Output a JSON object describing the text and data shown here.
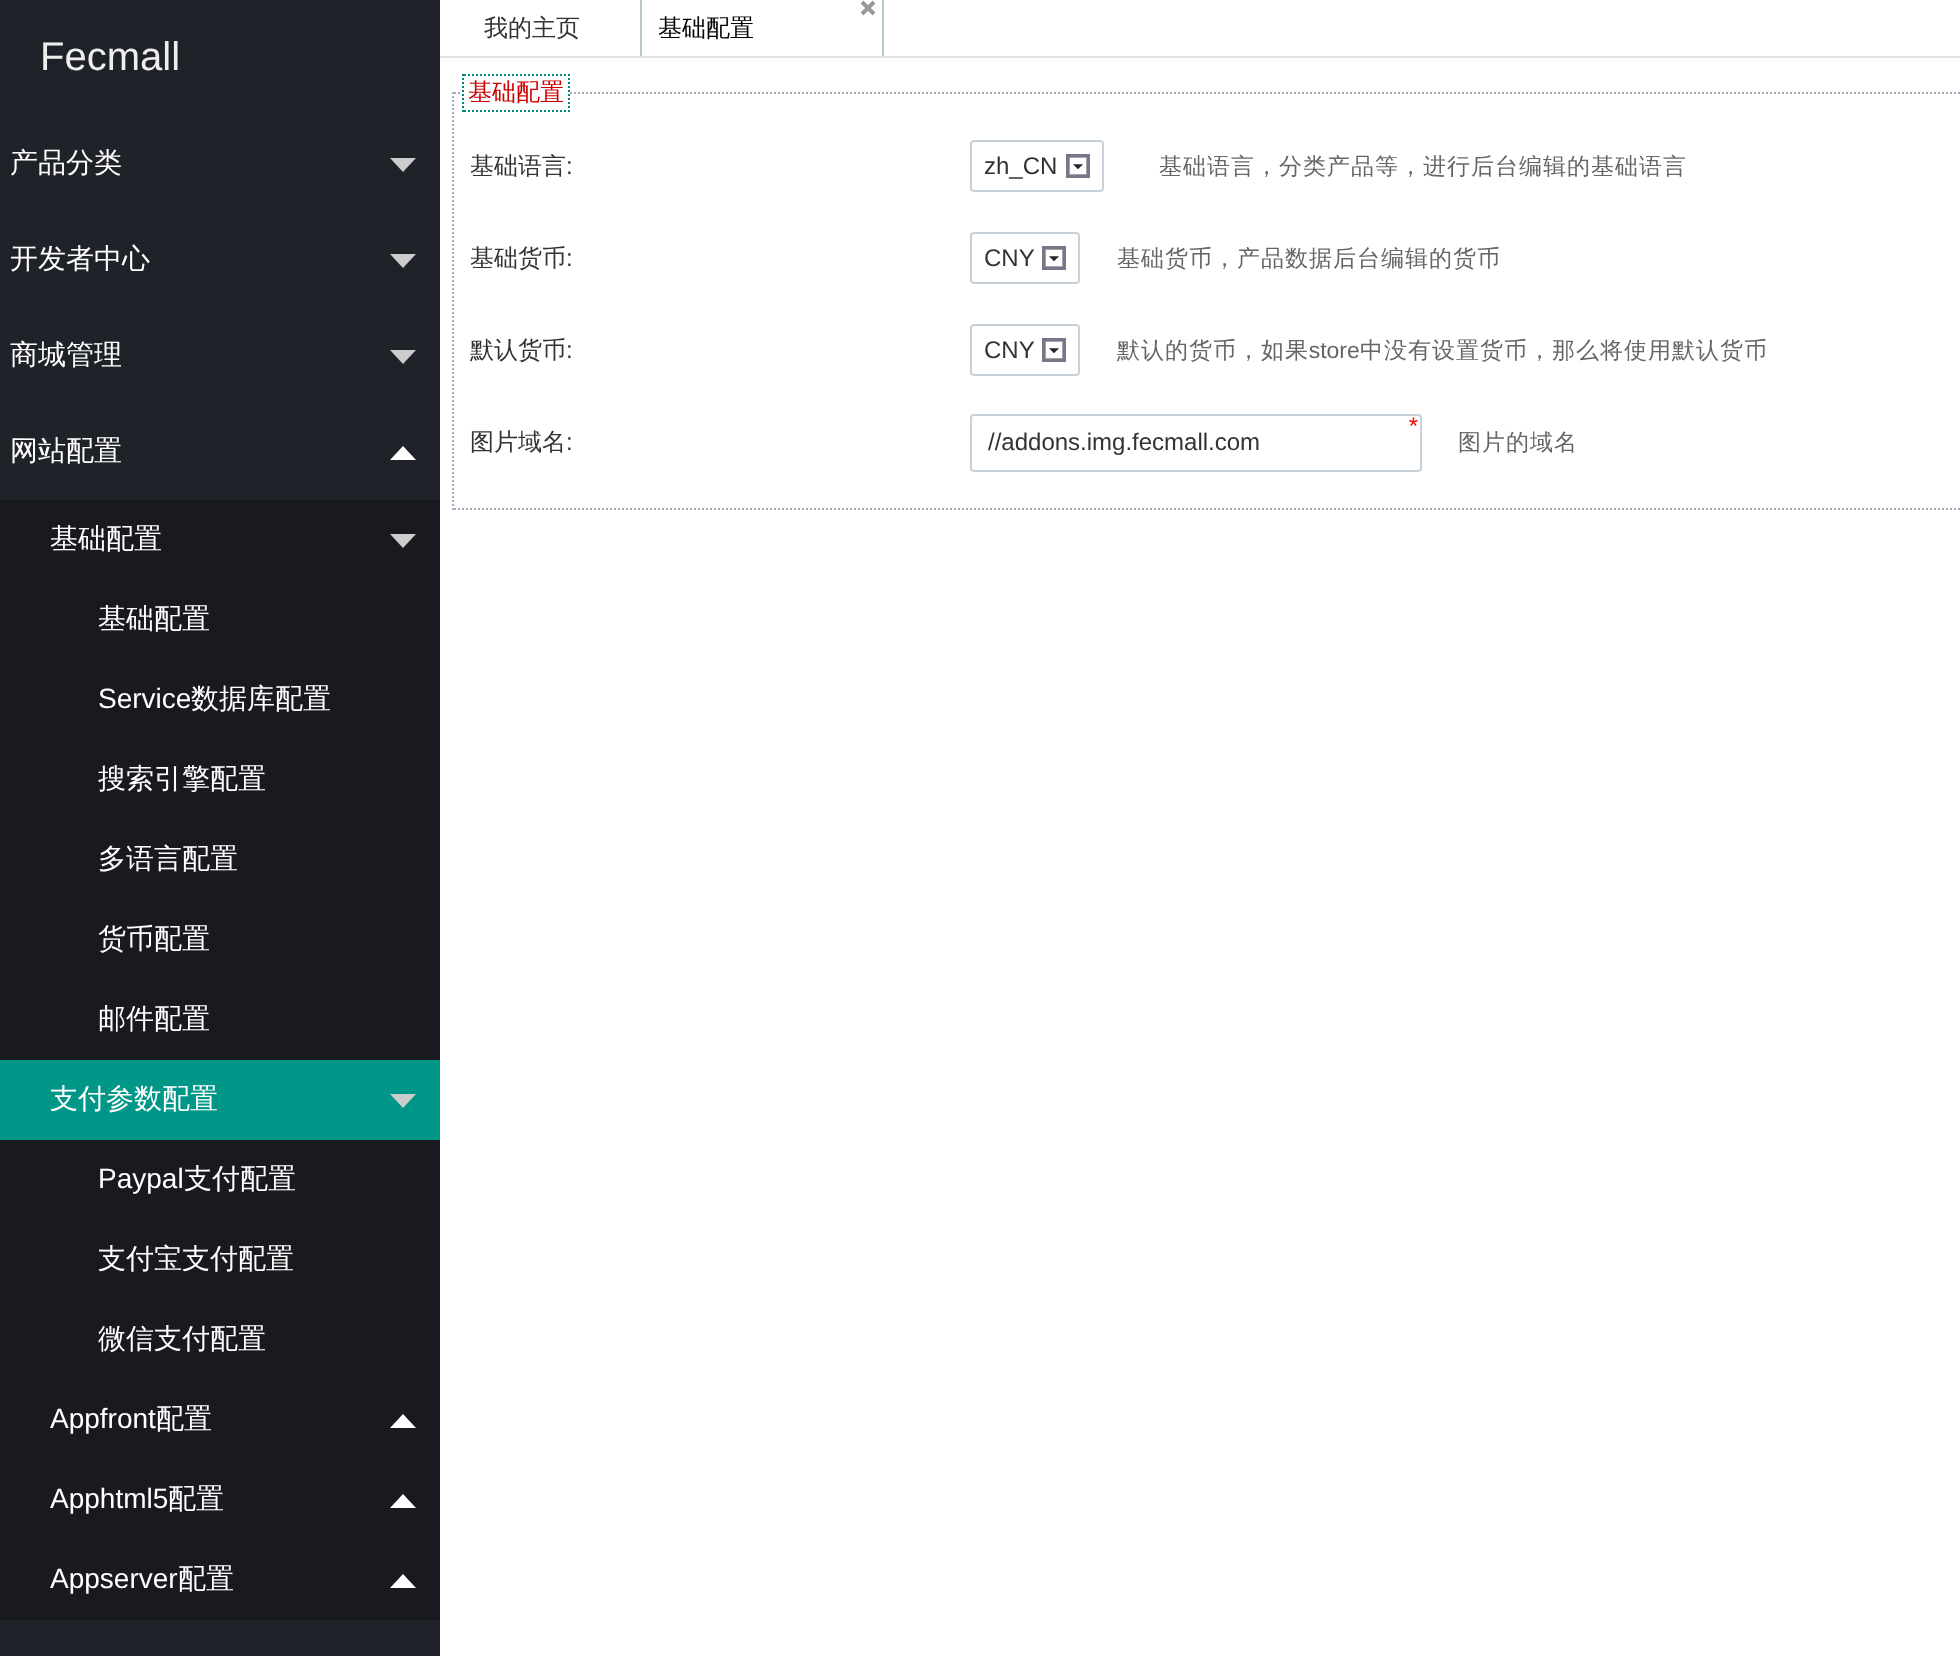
{
  "brand": "Fecmall",
  "sidebar": {
    "items": [
      {
        "label": "产品分类",
        "arrow_up": false,
        "selected": false
      },
      {
        "label": "开发者中心",
        "arrow_up": false,
        "selected": false
      },
      {
        "label": "商城管理",
        "arrow_up": false,
        "selected": false
      },
      {
        "label": "网站配置",
        "arrow_up": true,
        "selected": false,
        "children": [
          {
            "label": "基础配置",
            "arrow_up": false,
            "selected": false,
            "children": [
              {
                "label": "基础配置",
                "selected": false
              },
              {
                "label": "Service数据库配置",
                "selected": false
              },
              {
                "label": "搜索引擎配置",
                "selected": false
              },
              {
                "label": "多语言配置",
                "selected": false
              },
              {
                "label": "货币配置",
                "selected": false
              },
              {
                "label": "邮件配置",
                "selected": false
              }
            ]
          },
          {
            "label": "支付参数配置",
            "arrow_up": false,
            "selected": true,
            "children": [
              {
                "label": "Paypal支付配置",
                "selected": false
              },
              {
                "label": "支付宝支付配置",
                "selected": false
              },
              {
                "label": "微信支付配置",
                "selected": false
              }
            ]
          },
          {
            "label": "Appfront配置",
            "arrow_up": true,
            "selected": false
          },
          {
            "label": "Apphtml5配置",
            "arrow_up": true,
            "selected": false
          },
          {
            "label": "Appserver配置",
            "arrow_up": true,
            "selected": false
          }
        ]
      }
    ]
  },
  "tabs": [
    {
      "label": "我的主页",
      "selected": false,
      "closable": false
    },
    {
      "label": "基础配置",
      "selected": true,
      "closable": true
    }
  ],
  "form": {
    "legend": "基础配置",
    "fields": [
      {
        "kind": "select",
        "label": "基础语言:",
        "value": "zh_CN",
        "help": "基础语言，分类产品等，进行后台编辑的基础语言"
      },
      {
        "kind": "select",
        "label": "基础货币:",
        "value": "CNY",
        "help": "基础货币，产品数据后台编辑的货币"
      },
      {
        "kind": "select",
        "label": "默认货币:",
        "value": "CNY",
        "help": "默认的货币，如果store中没有设置货币，那么将使用默认货币"
      },
      {
        "kind": "text",
        "label": "图片域名:",
        "value": "//addons.img.fecmall.com",
        "required_mark": "*",
        "help": "图片的域名"
      }
    ]
  }
}
